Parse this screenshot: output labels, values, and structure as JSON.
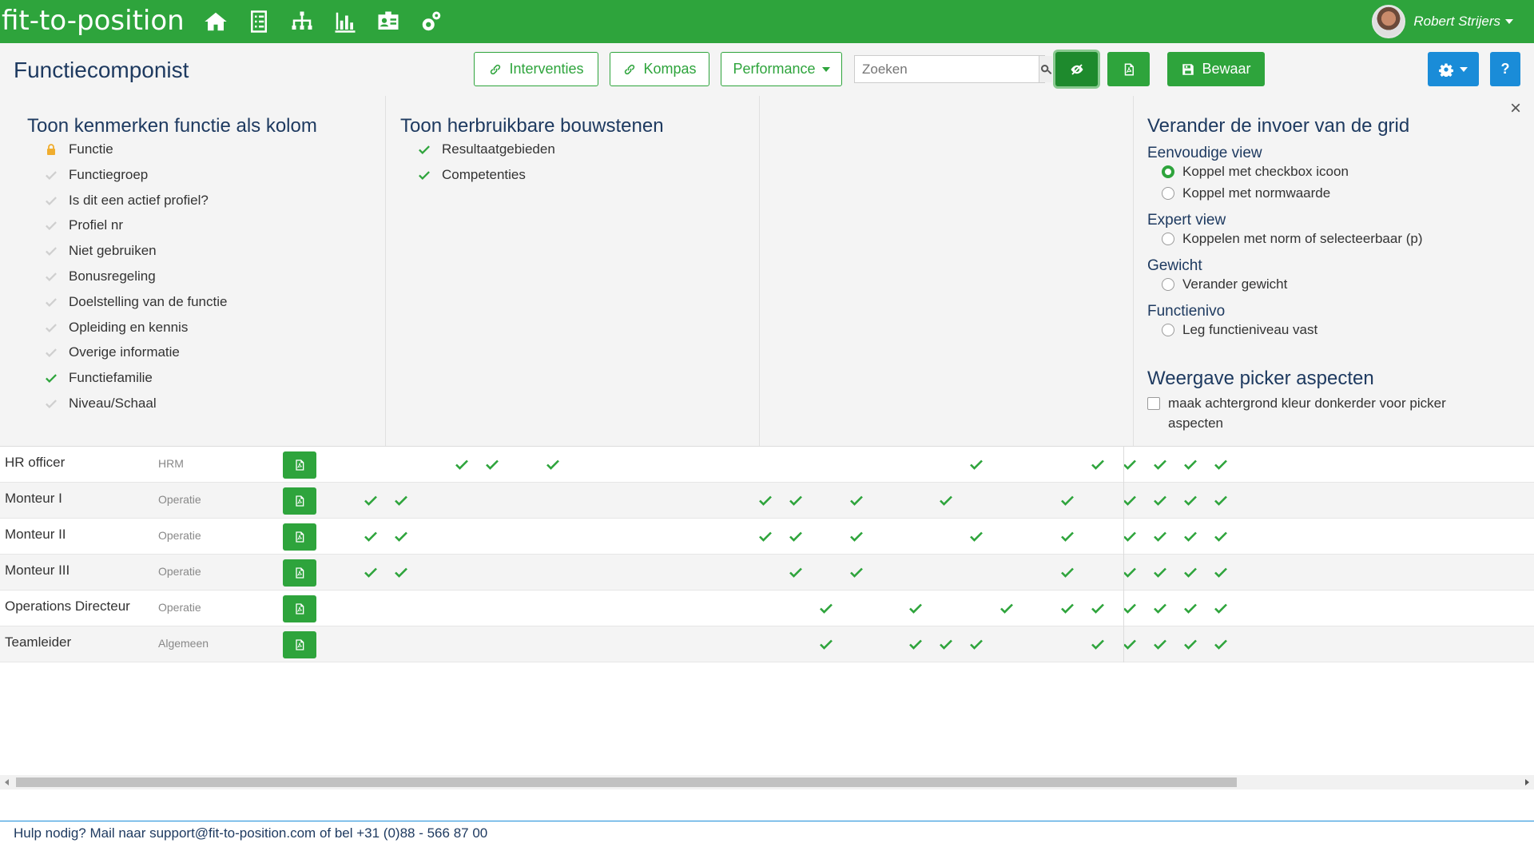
{
  "app": {
    "logo": "fit-to-position",
    "user": "Robert Strijers"
  },
  "nav_icons": [
    "home-icon",
    "checklist-icon",
    "org-chart-icon",
    "bar-chart-icon",
    "id-card-icon",
    "gears-icon"
  ],
  "toolbar": {
    "title": "Functiecomponist",
    "interventies": "Interventies",
    "kompas": "Kompas",
    "performance": "Performance",
    "search_placeholder": "Zoeken",
    "save": "Bewaar",
    "help": "?"
  },
  "panel": {
    "col1": {
      "title": "Toon kenmerken functie als kolom",
      "items": [
        {
          "label": "Functie",
          "state": "locked"
        },
        {
          "label": "Functiegroep",
          "state": "off"
        },
        {
          "label": "Is dit een actief profiel?",
          "state": "off"
        },
        {
          "label": "Profiel nr",
          "state": "off"
        },
        {
          "label": "Niet gebruiken",
          "state": "off"
        },
        {
          "label": "Bonusregeling",
          "state": "off"
        },
        {
          "label": "Doelstelling van de functie",
          "state": "off"
        },
        {
          "label": "Opleiding en kennis",
          "state": "off"
        },
        {
          "label": "Overige informatie",
          "state": "off"
        },
        {
          "label": "Functiefamilie",
          "state": "on"
        },
        {
          "label": "Niveau/Schaal",
          "state": "off"
        }
      ]
    },
    "col2": {
      "title": "Toon herbruikbare bouwstenen",
      "items": [
        {
          "label": "Resultaatgebieden",
          "state": "on"
        },
        {
          "label": "Competenties",
          "state": "on"
        }
      ]
    },
    "col4": {
      "title": "Verander de invoer van de grid",
      "simple_view": "Eenvoudige view",
      "simple_opt1": "Koppel met checkbox icoon",
      "simple_opt2": "Koppel met normwaarde",
      "expert_view": "Expert view",
      "expert_opt1": "Koppelen met norm of selecteerbaar (p)",
      "weight": "Gewicht",
      "weight_opt1": "Verander gewicht",
      "level": "Functienivo",
      "level_opt1": "Leg functieniveau vast",
      "picker_title": "Weergave picker aspecten",
      "picker_opt1": "maak achtergrond kleur donkerder voor picker aspecten",
      "close": "×"
    }
  },
  "grid": {
    "rows": [
      {
        "name": "HR officer",
        "group": "HRM"
      },
      {
        "name": "Monteur I",
        "group": "Operatie"
      },
      {
        "name": "Monteur II",
        "group": "Operatie"
      },
      {
        "name": "Monteur III",
        "group": "Operatie"
      },
      {
        "name": "Operations Directeur",
        "group": "Operatie"
      },
      {
        "name": "Teamleider",
        "group": "Algemeen"
      }
    ]
  },
  "footer": {
    "text": "Hulp nodig? Mail naar support@fit-to-position.com of bel +31 (0)88 - 566 87 00"
  },
  "colors": {
    "brand_green": "#2ea43c",
    "title_blue": "#1e3a60",
    "accent_blue": "#1a8cd8"
  }
}
